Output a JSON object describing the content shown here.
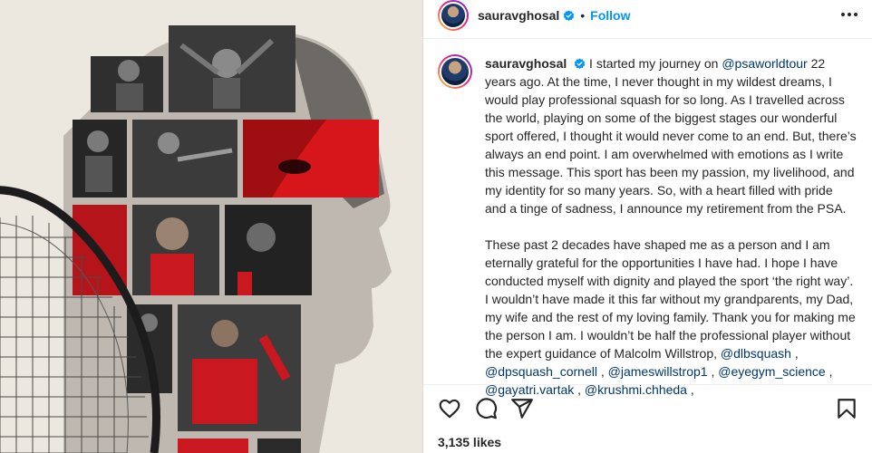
{
  "post": {
    "username": "sauravghosal",
    "separator": "•",
    "follow_label": "Follow",
    "likes_text": "3,135 likes"
  },
  "caption": {
    "username": "sauravghosal",
    "p1_a": "I started my journey on ",
    "p1_mention": "@psaworldtour",
    "p1_b": " 22 years ago. At the time, I never thought in my wildest dreams, I would play professional squash for so long. As I travelled across the world, playing on some of the biggest stages our wonderful sport offered, I thought it would never come to an end. But, there’s always an end point. I am overwhelmed with emotions as I write this message. This sport has been my passion, my livelihood, and my identity for so many years. So, with a heart filled with pride and a tinge of sadness, I announce my retirement from the PSA.",
    "p2": "These past 2 decades have shaped me as a person and I am eternally grateful for the opportunities I have had. I hope I have conducted myself with dignity and played the sport ‘the right way’. I wouldn’t have made it this far without my grandparents, my Dad, my wife and the rest of my loving family. Thank you for making me the person I am. I wouldn’t be half the professional player without the expert guidance of Malcolm Willstrop,",
    "mentions": [
      "@dlbsquash",
      "@dpsquash_cornell",
      "@jameswillstrop1",
      "@eyegym_science",
      "@gayatri.vartak",
      "@krushmi.chheda"
    ],
    "mention_sep": " , "
  },
  "icons": {
    "verified": "verified-badge-icon",
    "more": "more-options-icon",
    "like": "heart-icon",
    "comment": "comment-icon",
    "share": "share-icon",
    "save": "bookmark-icon"
  },
  "colors": {
    "link_blue": "#0095f6",
    "mention": "#00376b",
    "accent_red": "#d7161c",
    "poster_bg": "#ece8df"
  }
}
